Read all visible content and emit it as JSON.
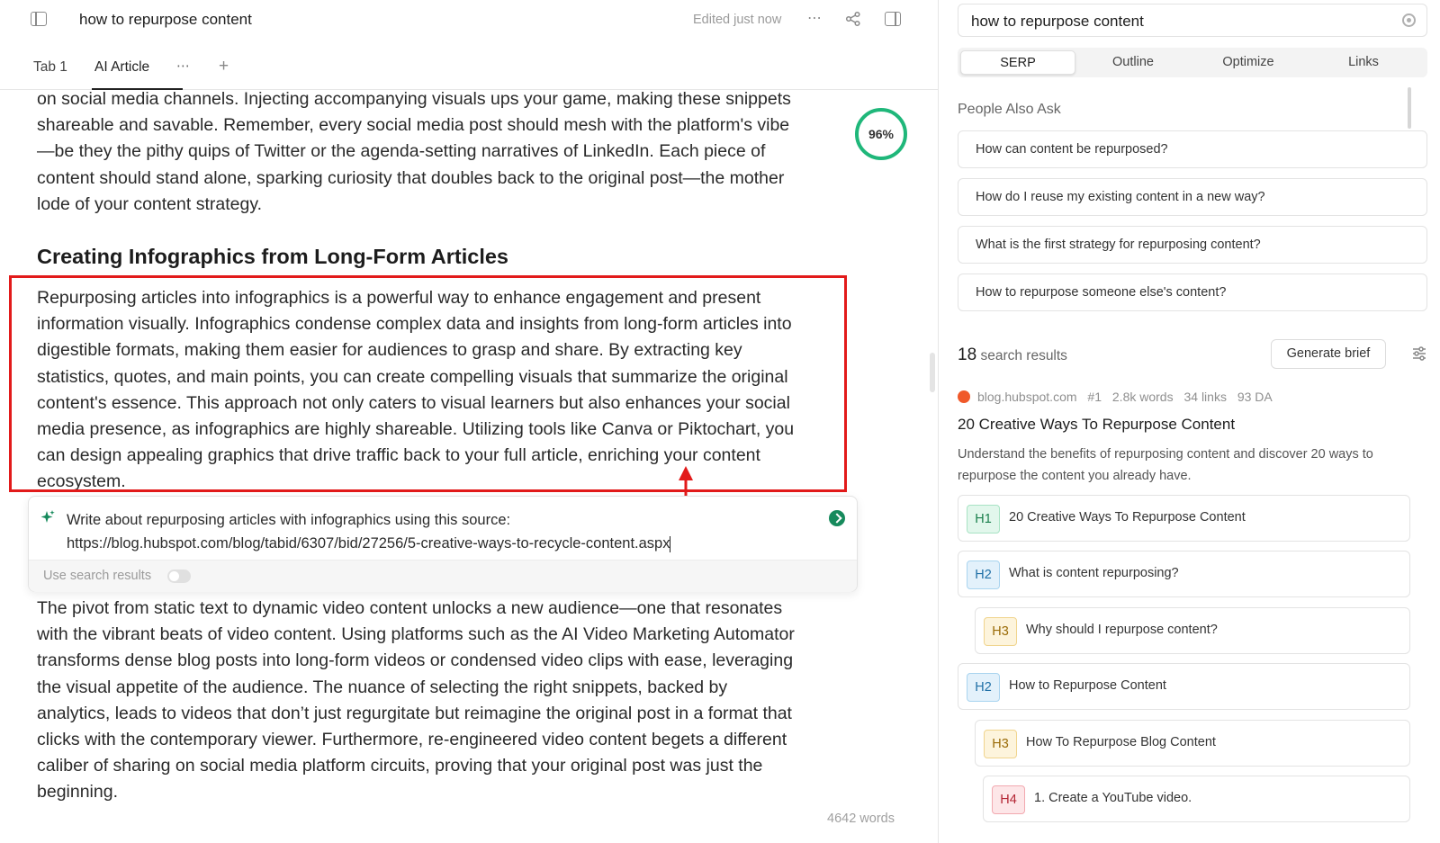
{
  "document": {
    "title": "how to repurpose content",
    "edited_status": "Edited just now",
    "more_label": "⋯",
    "tabs": [
      {
        "label": "Tab 1"
      },
      {
        "label": "AI Article"
      }
    ],
    "tab_more": "⋯",
    "tab_add": "+",
    "score": "96%",
    "intro_paragraph": "on social media channels. Injecting accompanying visuals ups your game, making these snippets shareable and savable. Remember, every social media post should mesh with the platform's vibe—be they the pithy quips of Twitter or the agenda-setting narratives of LinkedIn. Each piece of content should stand alone, sparking curiosity that doubles back to the original post—the mother lode of your content strategy.",
    "section_heading": "Creating Infographics from Long-Form Articles",
    "highlighted_paragraph": "Repurposing articles into infographics is a powerful way to enhance engagement and present information visually. Infographics condense complex data and insights from long-form articles into digestible formats, making them easier for audiences to grasp and share. By extracting key statistics, quotes, and main points, you can create compelling visuals that summarize the original content's essence. This approach not only caters to visual learners but also enhances your social media presence, as infographics are highly shareable. Utilizing tools like Canva or Piktochart, you can design appealing graphics that drive traffic back to your full article, enriching your content ecosystem.",
    "prompt": {
      "line1": "Write about repurposing articles with infographics using this source:",
      "line2": "https://blog.hubspot.com/blog/tabid/6307/bid/27256/5-creative-ways-to-recycle-content.aspx",
      "use_search_label": "Use search results",
      "use_search_enabled": false
    },
    "lower_paragraph": "The pivot from static text to dynamic video content unlocks a new audience—one that resonates with the vibrant beats of video content. Using platforms such as the AI Video Marketing Automator transforms dense blog posts into long-form videos or condensed video clips with ease, leveraging the visual appetite of the audience. The nuance of selecting the right snippets, backed by analytics, leads to videos that don’t just regurgitate but reimagine the original post in a format that clicks with the contemporary viewer. Furthermore, re-engineered video content begets a different caliber of sharing on social media platform circuits, proving that your original post was just the beginning.",
    "word_count": "4642 words"
  },
  "panel": {
    "search_value": "how to repurpose content",
    "tabs": [
      "SERP",
      "Outline",
      "Optimize",
      "Links"
    ],
    "active_tab": "SERP",
    "paa_title": "People Also Ask",
    "paa": [
      "How can content be repurposed?",
      "How do I reuse my existing content in a new way?",
      "What is the first strategy for repurposing content?",
      "How to repurpose someone else's content?"
    ],
    "results_count": "18",
    "results_label": "search results",
    "generate_brief": "Generate brief",
    "result": {
      "domain": "blog.hubspot.com",
      "rank": "#1",
      "words": "2.8k words",
      "links": "34 links",
      "da": "93 DA",
      "title": "20 Creative Ways To Repurpose Content",
      "description": "Understand the benefits of repurposing content and discover 20 ways to repurpose the content you already have."
    },
    "outline": [
      {
        "level": "H1",
        "text": "20 Creative Ways To Repurpose Content"
      },
      {
        "level": "H2",
        "text": "What is content repurposing?"
      },
      {
        "level": "H3",
        "text": "Why should I repurpose content?"
      },
      {
        "level": "H2",
        "text": "How to Repurpose Content"
      },
      {
        "level": "H3",
        "text": "How To Repurpose Blog Content"
      },
      {
        "level": "H4",
        "text": "1. Create a YouTube video."
      }
    ]
  },
  "colors": {
    "highlight": "#e21a1a",
    "score_ring": "#1fb77a",
    "send_button": "#168a5c"
  }
}
